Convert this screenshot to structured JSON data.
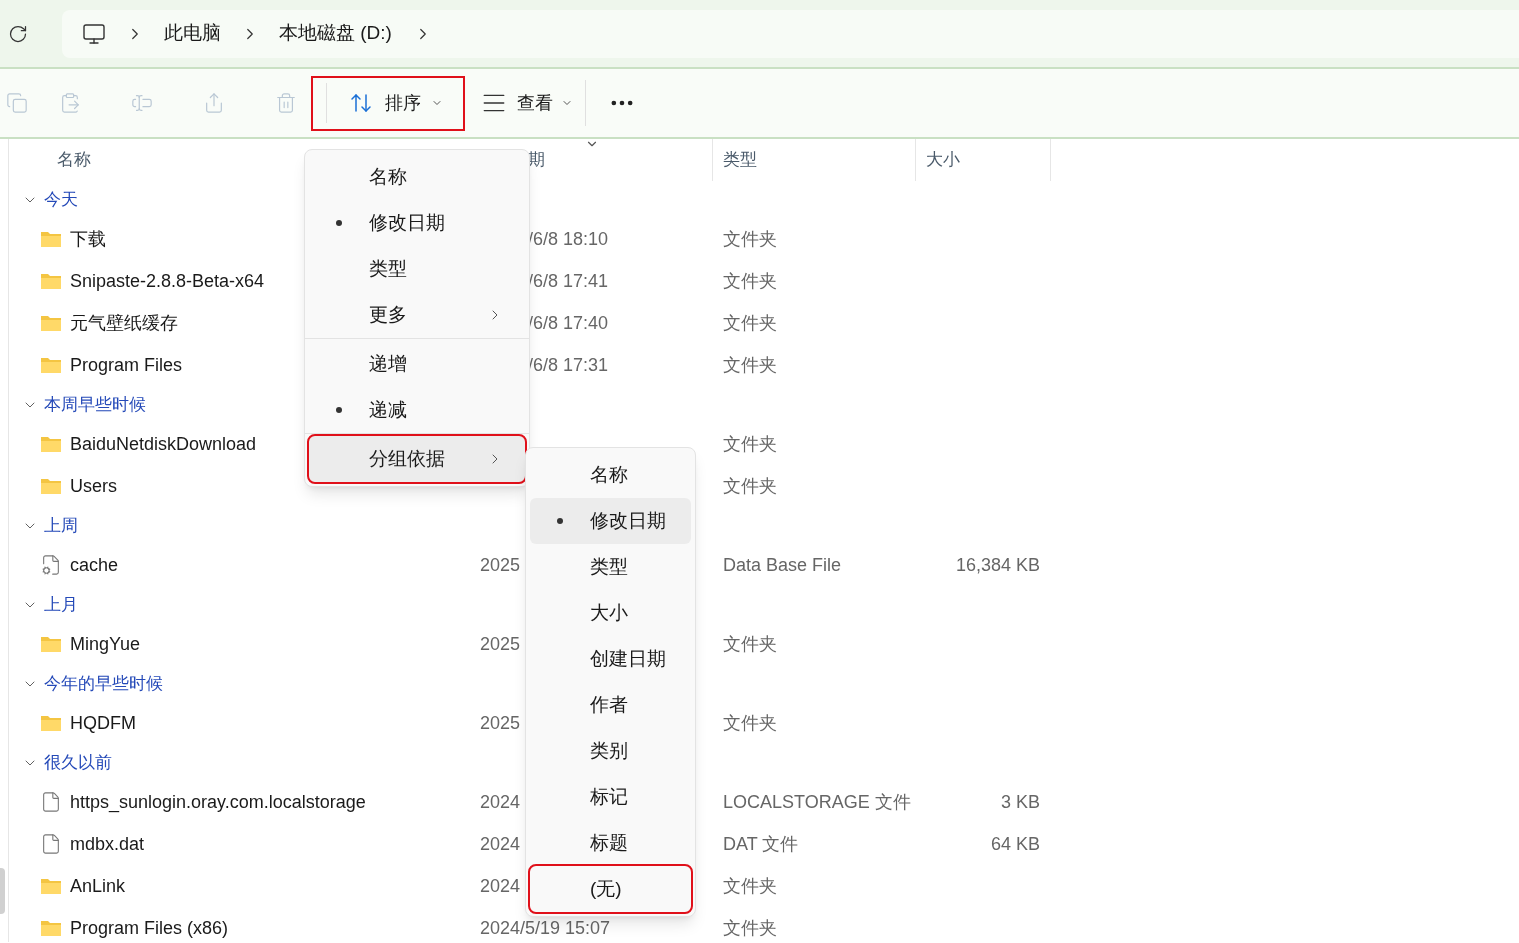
{
  "breadcrumb": [
    "此电脑",
    "本地磁盘 (D:)"
  ],
  "toolbar": {
    "actions": [
      {
        "kind": "copy",
        "disabled": true
      },
      {
        "kind": "paste",
        "disabled": true
      },
      {
        "kind": "rename",
        "disabled": true
      },
      {
        "kind": "share",
        "disabled": true
      },
      {
        "kind": "delete",
        "disabled": true
      }
    ],
    "sort": {
      "label": "排序",
      "highlighted": true
    },
    "view": {
      "label": "查看"
    }
  },
  "columns": [
    {
      "label": "名称"
    },
    {
      "label": "期",
      "sorted": true
    },
    {
      "label": "类型"
    },
    {
      "label": "大小"
    }
  ],
  "groups": [
    {
      "label": "今天",
      "expanded": true,
      "items": [
        {
          "kind": "folder",
          "name": "下载",
          "date": "/6/8 18:10",
          "date_cut": true,
          "type": "文件夹"
        },
        {
          "kind": "folder",
          "name": "Snipaste-2.8.8-Beta-x64",
          "date": "/6/8 17:41",
          "date_cut": true,
          "type": "文件夹"
        },
        {
          "kind": "folder",
          "name": "元气壁纸缓存",
          "date": "/6/8 17:40",
          "date_cut": true,
          "type": "文件夹"
        },
        {
          "kind": "folder",
          "name": "Program Files",
          "date": "/6/8 17:31",
          "date_cut": true,
          "type": "文件夹"
        }
      ]
    },
    {
      "label": "本周早些时候",
      "expanded": true,
      "items": [
        {
          "kind": "folder",
          "name": "BaiduNetdiskDownload",
          "type": "文件夹"
        },
        {
          "kind": "folder",
          "name": "Users",
          "type": "文件夹"
        }
      ]
    },
    {
      "label": "上周",
      "expanded": true,
      "items": [
        {
          "kind": "system",
          "name": "cache",
          "date": "2025",
          "type": "Data Base File",
          "size": "16,384 KB"
        }
      ]
    },
    {
      "label": "上月",
      "expanded": true,
      "items": [
        {
          "kind": "folder",
          "name": "MingYue",
          "date": "2025",
          "type": "文件夹"
        }
      ]
    },
    {
      "label": "今年的早些时候",
      "expanded": true,
      "items": [
        {
          "kind": "folder",
          "name": "HQDFM",
          "date": "2025",
          "type": "文件夹"
        }
      ]
    },
    {
      "label": "很久以前",
      "expanded": true,
      "items": [
        {
          "kind": "file",
          "name": "https_sunlogin.oray.com.localstorage",
          "date": "2024",
          "type": "LOCALSTORAGE 文件",
          "size": "3 KB"
        },
        {
          "kind": "file",
          "name": "mdbx.dat",
          "date": "2024",
          "type": "DAT 文件",
          "size": "64 KB"
        },
        {
          "kind": "folder",
          "name": "AnLink",
          "date": "2024",
          "type": "文件夹"
        },
        {
          "kind": "folder",
          "name": "Program Files (x86)",
          "date": "2024/5/19 15:07",
          "type": "文件夹"
        }
      ]
    }
  ],
  "sort_menu": {
    "sections": [
      {
        "items": [
          {
            "label": "名称",
            "selected": false
          },
          {
            "label": "修改日期",
            "selected": true
          },
          {
            "label": "类型",
            "selected": false
          },
          {
            "label": "更多",
            "selected": false,
            "submenu": true
          }
        ]
      },
      {
        "items": [
          {
            "label": "递增",
            "selected": false
          },
          {
            "label": "递减",
            "selected": true
          }
        ]
      },
      {
        "items": [
          {
            "label": "分组依据",
            "selected": false,
            "submenu": true,
            "hovered": true,
            "highlighted": true
          }
        ]
      }
    ]
  },
  "group_menu": {
    "items": [
      {
        "label": "名称",
        "selected": false
      },
      {
        "label": "修改日期",
        "selected": true,
        "hovered": true
      },
      {
        "label": "类型",
        "selected": false
      },
      {
        "label": "大小",
        "selected": false
      },
      {
        "label": "创建日期",
        "selected": false
      },
      {
        "label": "作者",
        "selected": false
      },
      {
        "label": "类别",
        "selected": false
      },
      {
        "label": "标记",
        "selected": false
      },
      {
        "label": "标题",
        "selected": false
      },
      {
        "label": "(无)",
        "selected": false,
        "highlighted": true
      }
    ]
  }
}
